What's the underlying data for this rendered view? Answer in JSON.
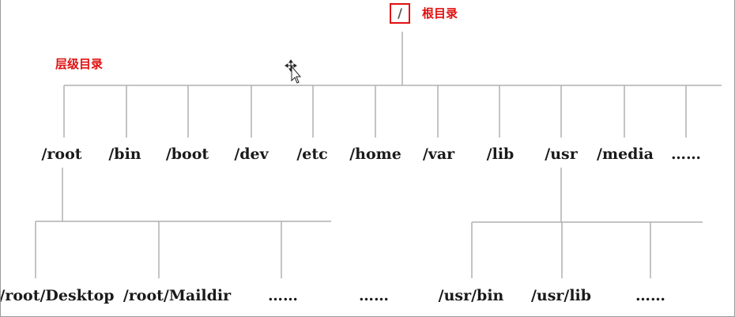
{
  "root": {
    "label": "/",
    "annotation": "根目录"
  },
  "level_annotation": "层级目录",
  "level1": [
    "/root",
    "/bin",
    "/boot",
    "/dev",
    "/etc",
    "/home",
    "/var",
    "/lib",
    "/usr",
    "/media",
    "……"
  ],
  "root_children": [
    "/root/Desktop",
    "/root/Maildir",
    "……",
    "……"
  ],
  "usr_children": [
    "/usr/bin",
    "/usr/lib",
    "……"
  ],
  "colors": {
    "annotation": "#e01010",
    "line": "#b0b0b0",
    "text": "#1a1a1a"
  },
  "icons": {
    "cursor": "move-cursor-icon"
  }
}
